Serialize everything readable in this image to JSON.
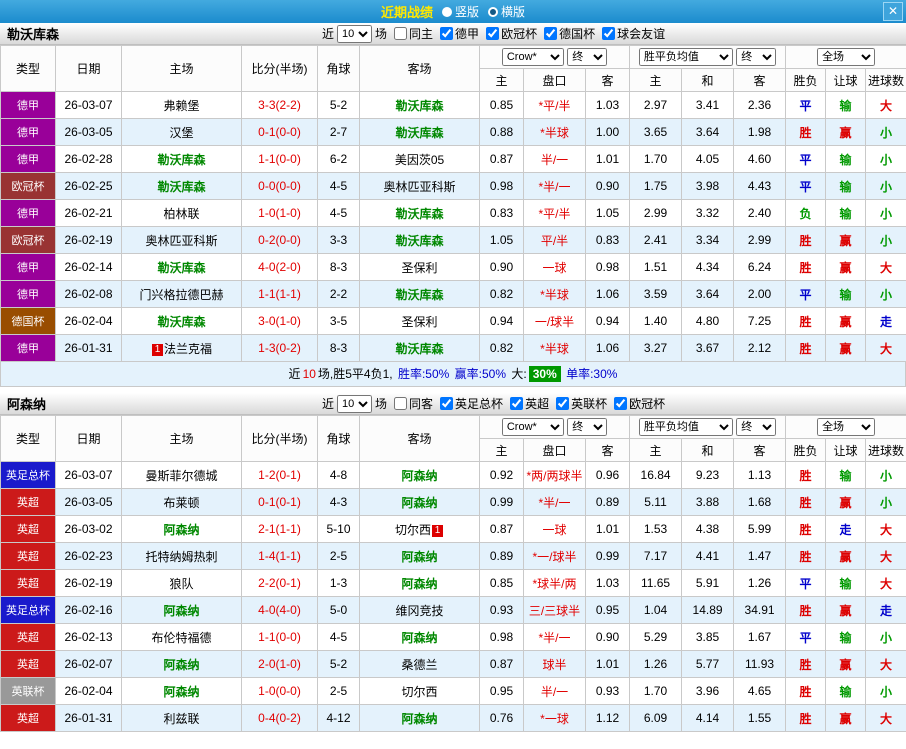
{
  "titlebar": {
    "title": "近期战绩",
    "radios": [
      {
        "label": "竖版",
        "selected": false
      },
      {
        "label": "横版",
        "selected": true
      }
    ],
    "close_glyph": "✕"
  },
  "table": {
    "headers": {
      "type": "类型",
      "date": "日期",
      "home": "主场",
      "score": "比分(半场)",
      "corners": "角球",
      "away": "客场",
      "odds_home": "主",
      "handicap": "盘口",
      "odds_away": "客",
      "avg_home": "主",
      "avg_draw": "和",
      "avg_away": "客",
      "result": "胜负",
      "handicap_result": "让球",
      "goals": "进球数"
    },
    "odds_source": "Crow*",
    "state_final": "终",
    "avg_label": "胜平负均值",
    "scope": "全场"
  },
  "league_colors": {
    "德甲": "#990099",
    "欧冠杯": "#993333",
    "德国杯": "#994d00",
    "英足总杯": "#1a1acc",
    "英超": "#cc1a1a",
    "英联杯": "#999999"
  },
  "sections": [
    {
      "team": "勒沃库森",
      "filter": {
        "near_label": "近",
        "count": "10",
        "games_label": "场",
        "checkboxes": [
          {
            "label": "同主",
            "checked": false
          },
          {
            "label": "德甲",
            "checked": true
          },
          {
            "label": "欧冠杯",
            "checked": true
          },
          {
            "label": "德国杯",
            "checked": true
          },
          {
            "label": "球会友谊",
            "checked": true
          }
        ]
      },
      "rows": [
        {
          "league": "德甲",
          "date": "26-03-07",
          "home": "弗赖堡",
          "home_hl": false,
          "score": "3-3(2-2)",
          "corners": "5-2",
          "away": "勒沃库森",
          "away_hl": true,
          "odds": [
            "0.85",
            "*平/半",
            "1.03"
          ],
          "avg": [
            "2.97",
            "3.41",
            "2.36"
          ],
          "verdict": [
            "平",
            "输",
            "大"
          ]
        },
        {
          "league": "德甲",
          "date": "26-03-05",
          "home": "汉堡",
          "home_hl": false,
          "score": "0-1(0-0)",
          "corners": "2-7",
          "away": "勒沃库森",
          "away_hl": true,
          "odds": [
            "0.88",
            "*半球",
            "1.00"
          ],
          "avg": [
            "3.65",
            "3.64",
            "1.98"
          ],
          "verdict": [
            "胜",
            "赢",
            "小"
          ]
        },
        {
          "league": "德甲",
          "date": "26-02-28",
          "home": "勒沃库森",
          "home_hl": true,
          "score": "1-1(0-0)",
          "corners": "6-2",
          "away": "美因茨05",
          "away_hl": false,
          "odds": [
            "0.87",
            "半/一",
            "1.01"
          ],
          "avg": [
            "1.70",
            "4.05",
            "4.60"
          ],
          "verdict": [
            "平",
            "输",
            "小"
          ]
        },
        {
          "league": "欧冠杯",
          "date": "26-02-25",
          "home": "勒沃库森",
          "home_hl": true,
          "score": "0-0(0-0)",
          "corners": "4-5",
          "away": "奥林匹亚科斯",
          "away_hl": false,
          "odds": [
            "0.98",
            "*半/一",
            "0.90"
          ],
          "avg": [
            "1.75",
            "3.98",
            "4.43"
          ],
          "verdict": [
            "平",
            "输",
            "小"
          ]
        },
        {
          "league": "德甲",
          "date": "26-02-21",
          "home": "柏林联",
          "home_hl": false,
          "score": "1-0(1-0)",
          "corners": "4-5",
          "away": "勒沃库森",
          "away_hl": true,
          "odds": [
            "0.83",
            "*平/半",
            "1.05"
          ],
          "avg": [
            "2.99",
            "3.32",
            "2.40"
          ],
          "verdict": [
            "负",
            "输",
            "小"
          ]
        },
        {
          "league": "欧冠杯",
          "date": "26-02-19",
          "home": "奥林匹亚科斯",
          "home_hl": false,
          "score": "0-2(0-0)",
          "corners": "3-3",
          "away": "勒沃库森",
          "away_hl": true,
          "odds": [
            "1.05",
            "平/半",
            "0.83"
          ],
          "avg": [
            "2.41",
            "3.34",
            "2.99"
          ],
          "verdict": [
            "胜",
            "赢",
            "小"
          ]
        },
        {
          "league": "德甲",
          "date": "26-02-14",
          "home": "勒沃库森",
          "home_hl": true,
          "score": "4-0(2-0)",
          "corners": "8-3",
          "away": "圣保利",
          "away_hl": false,
          "odds": [
            "0.90",
            "一球",
            "0.98"
          ],
          "avg": [
            "1.51",
            "4.34",
            "6.24"
          ],
          "verdict": [
            "胜",
            "赢",
            "大"
          ]
        },
        {
          "league": "德甲",
          "date": "26-02-08",
          "home": "门兴格拉德巴赫",
          "home_hl": false,
          "score": "1-1(1-1)",
          "corners": "2-2",
          "away": "勒沃库森",
          "away_hl": true,
          "odds": [
            "0.82",
            "*半球",
            "1.06"
          ],
          "avg": [
            "3.59",
            "3.64",
            "2.00"
          ],
          "verdict": [
            "平",
            "输",
            "小"
          ]
        },
        {
          "league": "德国杯",
          "date": "26-02-04",
          "home": "勒沃库森",
          "home_hl": true,
          "score": "3-0(1-0)",
          "corners": "3-5",
          "away": "圣保利",
          "away_hl": false,
          "odds": [
            "0.94",
            "一/球半",
            "0.94"
          ],
          "avg": [
            "1.40",
            "4.80",
            "7.25"
          ],
          "verdict": [
            "胜",
            "赢",
            "走"
          ]
        },
        {
          "league": "德甲",
          "date": "26-01-31",
          "home": "法兰克福",
          "home_hl": false,
          "home_card": "1",
          "home_card_pos": "before",
          "score": "1-3(0-2)",
          "corners": "8-3",
          "away": "勒沃库森",
          "away_hl": true,
          "odds": [
            "0.82",
            "*半球",
            "1.06"
          ],
          "avg": [
            "3.27",
            "3.67",
            "2.12"
          ],
          "verdict": [
            "胜",
            "赢",
            "大"
          ]
        }
      ],
      "summary": {
        "prefix": "近",
        "count": "10",
        "record": "场,胜5平4负1,",
        "win_rate": "胜率:50%",
        "odds_rate": "赢率:50%",
        "big_label": "大:",
        "big_value": "30%",
        "single_rate": "单率:30%"
      }
    },
    {
      "team": "阿森纳",
      "filter": {
        "near_label": "近",
        "count": "10",
        "games_label": "场",
        "checkboxes": [
          {
            "label": "同客",
            "checked": false
          },
          {
            "label": "英足总杯",
            "checked": true
          },
          {
            "label": "英超",
            "checked": true
          },
          {
            "label": "英联杯",
            "checked": true
          },
          {
            "label": "欧冠杯",
            "checked": true
          }
        ]
      },
      "rows": [
        {
          "league": "英足总杯",
          "date": "26-03-07",
          "home": "曼斯菲尔德城",
          "home_hl": false,
          "score": "1-2(0-1)",
          "corners": "4-8",
          "away": "阿森纳",
          "away_hl": true,
          "odds": [
            "0.92",
            "*两/两球半",
            "0.96"
          ],
          "avg": [
            "16.84",
            "9.23",
            "1.13"
          ],
          "verdict": [
            "胜",
            "输",
            "小"
          ]
        },
        {
          "league": "英超",
          "date": "26-03-05",
          "home": "布莱顿",
          "home_hl": false,
          "score": "0-1(0-1)",
          "corners": "4-3",
          "away": "阿森纳",
          "away_hl": true,
          "odds": [
            "0.99",
            "*半/一",
            "0.89"
          ],
          "avg": [
            "5.11",
            "3.88",
            "1.68"
          ],
          "verdict": [
            "胜",
            "赢",
            "小"
          ]
        },
        {
          "league": "英超",
          "date": "26-03-02",
          "home": "阿森纳",
          "home_hl": true,
          "score": "2-1(1-1)",
          "corners": "5-10",
          "away": "切尔西",
          "away_hl": false,
          "away_card": "1",
          "away_card_pos": "after",
          "odds": [
            "0.87",
            "一球",
            "1.01"
          ],
          "avg": [
            "1.53",
            "4.38",
            "5.99"
          ],
          "verdict": [
            "胜",
            "走",
            "大"
          ]
        },
        {
          "league": "英超",
          "date": "26-02-23",
          "home": "托特纳姆热刺",
          "home_hl": false,
          "score": "1-4(1-1)",
          "corners": "2-5",
          "away": "阿森纳",
          "away_hl": true,
          "odds": [
            "0.89",
            "*一/球半",
            "0.99"
          ],
          "avg": [
            "7.17",
            "4.41",
            "1.47"
          ],
          "verdict": [
            "胜",
            "赢",
            "大"
          ]
        },
        {
          "league": "英超",
          "date": "26-02-19",
          "home": "狼队",
          "home_hl": false,
          "score": "2-2(0-1)",
          "corners": "1-3",
          "away": "阿森纳",
          "away_hl": true,
          "odds": [
            "0.85",
            "*球半/两",
            "1.03"
          ],
          "avg": [
            "11.65",
            "5.91",
            "1.26"
          ],
          "verdict": [
            "平",
            "输",
            "大"
          ]
        },
        {
          "league": "英足总杯",
          "date": "26-02-16",
          "home": "阿森纳",
          "home_hl": true,
          "score": "4-0(4-0)",
          "corners": "5-0",
          "away": "维冈竞技",
          "away_hl": false,
          "odds": [
            "0.93",
            "三/三球半",
            "0.95"
          ],
          "avg": [
            "1.04",
            "14.89",
            "34.91"
          ],
          "verdict": [
            "胜",
            "赢",
            "走"
          ]
        },
        {
          "league": "英超",
          "date": "26-02-13",
          "home": "布伦特福德",
          "home_hl": false,
          "score": "1-1(0-0)",
          "corners": "4-5",
          "away": "阿森纳",
          "away_hl": true,
          "odds": [
            "0.98",
            "*半/一",
            "0.90"
          ],
          "avg": [
            "5.29",
            "3.85",
            "1.67"
          ],
          "verdict": [
            "平",
            "输",
            "小"
          ]
        },
        {
          "league": "英超",
          "date": "26-02-07",
          "home": "阿森纳",
          "home_hl": true,
          "score": "2-0(1-0)",
          "corners": "5-2",
          "away": "桑德兰",
          "away_hl": false,
          "odds": [
            "0.87",
            "球半",
            "1.01"
          ],
          "avg": [
            "1.26",
            "5.77",
            "11.93"
          ],
          "verdict": [
            "胜",
            "赢",
            "大"
          ]
        },
        {
          "league": "英联杯",
          "date": "26-02-04",
          "home": "阿森纳",
          "home_hl": true,
          "score": "1-0(0-0)",
          "corners": "2-5",
          "away": "切尔西",
          "away_hl": false,
          "odds": [
            "0.95",
            "半/一",
            "0.93"
          ],
          "avg": [
            "1.70",
            "3.96",
            "4.65"
          ],
          "verdict": [
            "胜",
            "输",
            "小"
          ]
        },
        {
          "league": "英超",
          "date": "26-01-31",
          "home": "利兹联",
          "home_hl": false,
          "score": "0-4(0-2)",
          "corners": "4-12",
          "away": "阿森纳",
          "away_hl": true,
          "odds": [
            "0.76",
            "*一球",
            "1.12"
          ],
          "avg": [
            "6.09",
            "4.14",
            "1.55"
          ],
          "verdict": [
            "胜",
            "赢",
            "大"
          ]
        }
      ]
    }
  ]
}
